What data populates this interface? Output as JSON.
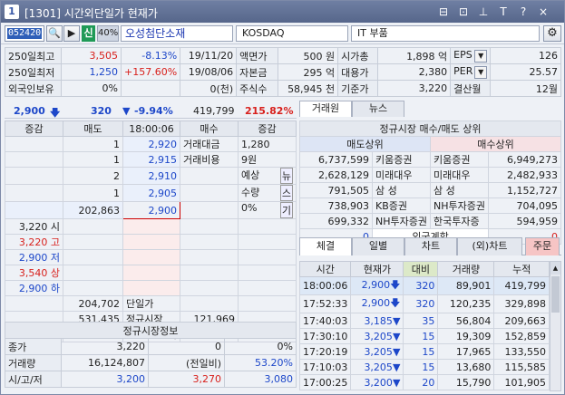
{
  "title": {
    "num": "1",
    "text": "[1301] 시간외단일가 현재가",
    "btns": [
      "⊟",
      "⊡",
      "⊥",
      "T",
      "?",
      "×"
    ]
  },
  "toolbar": {
    "code": "052420",
    "search": "🔍",
    "nav": "▶",
    "shin": "신",
    "pct": "40%",
    "name": "오성첨단소재",
    "market": "KOSDAQ",
    "sector": "IT 부품"
  },
  "info": {
    "rows": [
      [
        "250일최고",
        "3,505",
        "-8.13%",
        "19/11/20",
        "액면가",
        "500 원",
        "시가총",
        "1,898 억",
        "EPS",
        "126"
      ],
      [
        "250일최저",
        "1,250",
        "+157.60%",
        "19/08/06",
        "자본금",
        "295 억",
        "대용가",
        "2,380",
        "PER",
        "25.57"
      ],
      [
        "외국인보유",
        "0%",
        "",
        "0(천)",
        "주식수",
        "58,945 천",
        "기준가",
        "3,220",
        "결산월",
        "12월"
      ]
    ]
  },
  "pricebar": {
    "price": "2,900",
    "chg": "320",
    "rate": "-9.94%",
    "vol": "419,799",
    "vr": "215.82%"
  },
  "orderbook": {
    "headers": [
      "증감",
      "매도",
      "18:00:06",
      "매수",
      "증감"
    ],
    "rows": [
      {
        "a": "",
        "b": "1",
        "c": "2,920",
        "d": "거래대금",
        "e": "1,280"
      },
      {
        "a": "",
        "b": "1",
        "c": "2,915",
        "d": "거래비용",
        "e": "9원"
      },
      {
        "a": "",
        "b": "2",
        "c": "2,910",
        "d": "",
        "e": "예상"
      },
      {
        "a": "",
        "b": "1",
        "c": "2,905",
        "d": "",
        "e": "수량"
      },
      {
        "a": "",
        "b": "202,863",
        "c": "2,900",
        "d": "",
        "e": "0%"
      },
      {
        "a": "3,220 시",
        "b": "",
        "c": "",
        "d": "",
        "e": ""
      },
      {
        "a": "3,220 고",
        "b": "",
        "c": "",
        "d": "",
        "e": ""
      },
      {
        "a": "2,900 저",
        "b": "",
        "c": "",
        "d": "",
        "e": ""
      },
      {
        "a": "3,540 상",
        "b": "",
        "c": "",
        "d": "",
        "e": ""
      },
      {
        "a": "2,900 하",
        "b": "",
        "c": "",
        "d": "",
        "e": ""
      }
    ],
    "side": [
      "뉴",
      "스",
      "기"
    ],
    "tot": [
      {
        "s": "204,702",
        "lab": "단일가",
        "b": ""
      },
      {
        "s": "531,435",
        "lab": "정규시장",
        "b": "121,969"
      },
      {
        "s": "",
        "lab": "시간외",
        "b": "110,915"
      }
    ]
  },
  "sinfo": {
    "title": "정규시장정보",
    "rows": [
      [
        "종가",
        "3,220",
        "0",
        "0%"
      ],
      [
        "거래량",
        "16,124,807",
        "(전일비)",
        "53.20%"
      ],
      [
        "시/고/저",
        "3,200",
        "3,270",
        "3,080"
      ]
    ]
  },
  "right": {
    "tabs": [
      "거래원",
      "뉴스"
    ],
    "brokTitle": "정규시장 매수/매도 상위",
    "sellHdr": "매도상위",
    "buyHdr": "매수상위",
    "brok": [
      [
        "6,737,599",
        "키움증권",
        "키움증권",
        "6,949,273"
      ],
      [
        "2,628,129",
        "미래대우",
        "미래대우",
        "2,482,933"
      ],
      [
        "791,505",
        "삼   성",
        "삼   성",
        "1,152,727"
      ],
      [
        "738,903",
        "KB증권",
        "NH투자증권",
        "704,095"
      ],
      [
        "699,332",
        "NH투자증권",
        "한국투자증",
        "594,959"
      ]
    ],
    "foreign": [
      "0",
      "외국계합",
      "0"
    ],
    "tabs2": [
      "체결",
      "일별",
      "차트",
      "(외)차트",
      "주문"
    ],
    "tickHdr": [
      "시간",
      "현재가",
      "대비",
      "거래량",
      "누적"
    ],
    "ticks": [
      [
        "18:00:06",
        "2,900",
        "320",
        "89,901",
        "419,799"
      ],
      [
        "17:52:33",
        "2,900",
        "320",
        "120,235",
        "329,898"
      ],
      [
        "17:40:03",
        "3,185",
        "35",
        "56,804",
        "209,663"
      ],
      [
        "17:30:10",
        "3,205",
        "15",
        "19,309",
        "152,859"
      ],
      [
        "17:20:19",
        "3,205",
        "15",
        "17,965",
        "133,550"
      ],
      [
        "17:10:03",
        "3,205",
        "15",
        "13,680",
        "115,585"
      ],
      [
        "17:00:25",
        "3,200",
        "20",
        "15,790",
        "101,905"
      ]
    ]
  }
}
